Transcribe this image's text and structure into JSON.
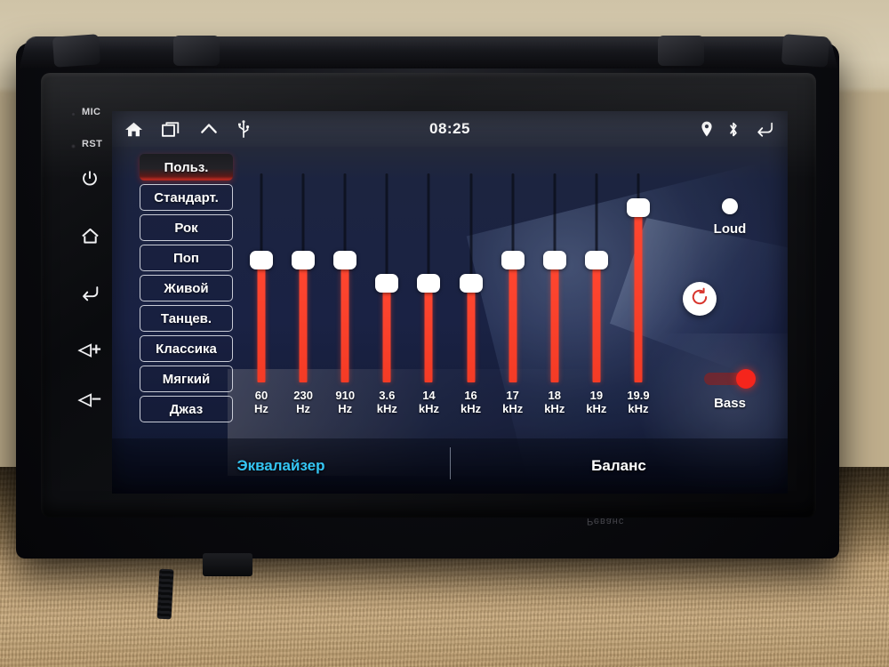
{
  "device": {
    "bezel_labels": [
      {
        "name": "mic",
        "text": "MIC"
      },
      {
        "name": "reset",
        "text": "RST"
      }
    ],
    "hardware_buttons": [
      {
        "name": "power-button",
        "icon": "power-icon"
      },
      {
        "name": "home-button",
        "icon": "home-icon"
      },
      {
        "name": "back-button",
        "icon": "back-arrow-icon"
      },
      {
        "name": "volume-up-button",
        "icon": "volume-up-icon",
        "glyph": "◁+"
      },
      {
        "name": "volume-down-button",
        "icon": "volume-down-icon",
        "glyph": "◁−"
      }
    ],
    "rear_text": "Реванс"
  },
  "statusbar": {
    "clock": "08:25",
    "left_icons": [
      {
        "name": "home-icon",
        "label": "home"
      },
      {
        "name": "recent-apps-icon",
        "label": "recent apps"
      },
      {
        "name": "chevron-up-icon",
        "label": "expand"
      },
      {
        "name": "usb-icon",
        "label": "usb"
      }
    ],
    "right_icons": [
      {
        "name": "location-pin-icon",
        "label": "location"
      },
      {
        "name": "bluetooth-icon",
        "label": "bluetooth"
      },
      {
        "name": "back-arrow-icon",
        "label": "back"
      }
    ]
  },
  "presets": {
    "selected": "Польз.",
    "items": [
      {
        "label": "Польз.",
        "active": true
      },
      {
        "label": "Стандарт.",
        "active": false
      },
      {
        "label": "Рок",
        "active": false
      },
      {
        "label": "Поп",
        "active": false
      },
      {
        "label": "Живой",
        "active": false
      },
      {
        "label": "Танцев.",
        "active": false
      },
      {
        "label": "Классика",
        "active": false
      },
      {
        "label": "Мягкий",
        "active": false
      },
      {
        "label": "Джаз",
        "active": false
      }
    ]
  },
  "equalizer": {
    "bands": [
      {
        "label": "60\nHz",
        "freq": "60",
        "unit": "Hz",
        "level_pct": 63
      },
      {
        "label": "230\nHz",
        "freq": "230",
        "unit": "Hz",
        "level_pct": 63
      },
      {
        "label": "910\nHz",
        "freq": "910",
        "unit": "Hz",
        "level_pct": 63
      },
      {
        "label": "3.6\nkHz",
        "freq": "3.6",
        "unit": "kHz",
        "level_pct": 52
      },
      {
        "label": "14\nkHz",
        "freq": "14",
        "unit": "kHz",
        "level_pct": 52
      },
      {
        "label": "16\nkHz",
        "freq": "16",
        "unit": "kHz",
        "level_pct": 52
      },
      {
        "label": "17\nkHz",
        "freq": "17",
        "unit": "kHz",
        "level_pct": 63
      },
      {
        "label": "18\nkHz",
        "freq": "18",
        "unit": "kHz",
        "level_pct": 63
      },
      {
        "label": "19\nkHz",
        "freq": "19",
        "unit": "kHz",
        "level_pct": 63
      },
      {
        "label": "19.9\nkHz",
        "freq": "19.9",
        "unit": "kHz",
        "level_pct": 88
      }
    ]
  },
  "side_controls": {
    "loud": {
      "label": "Loud",
      "state": "off"
    },
    "bass": {
      "label": "Bass",
      "state": "on"
    },
    "reset": {
      "name": "reset-eq-button",
      "icon": "refresh-icon"
    }
  },
  "tabs": [
    {
      "label": "Эквалайзер",
      "active": true
    },
    {
      "label": "Баланс",
      "active": false
    }
  ],
  "colors": {
    "accent_cyan": "#35c6f4",
    "slider_red": "#f43b25",
    "screen_blue": "#1a2244",
    "toggle_on_red": "#f5251c"
  }
}
